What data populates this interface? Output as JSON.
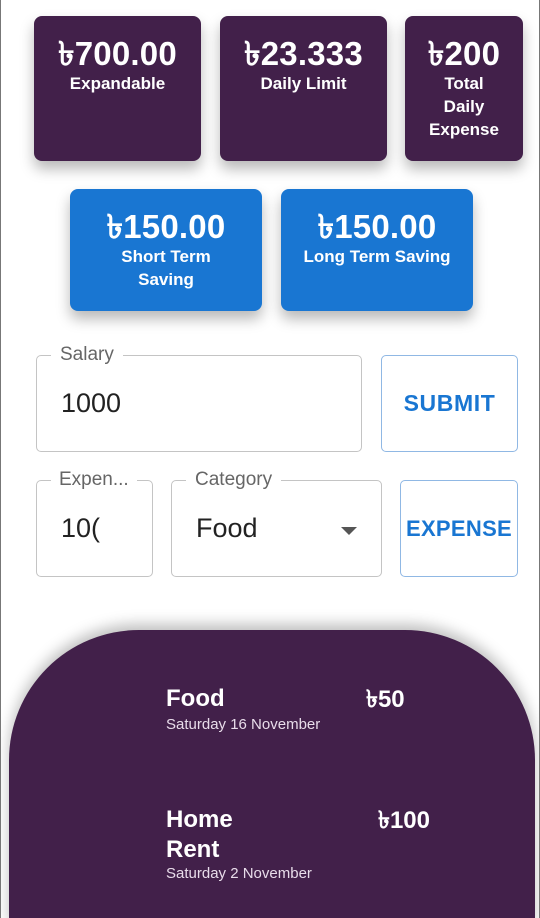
{
  "summary": {
    "expandable": {
      "amount": "৳700.00",
      "label": "Expandable"
    },
    "daily_limit": {
      "amount": "৳23.333",
      "label": "Daily Limit"
    },
    "total_daily_expense": {
      "amount": "৳200",
      "label_lines": [
        "Total",
        "Daily",
        "Expense"
      ]
    }
  },
  "savings": {
    "short_term": {
      "amount": "৳150.00",
      "label_lines": [
        "Short Term",
        "Saving"
      ]
    },
    "long_term": {
      "amount": "৳150.00",
      "label": "Long Term Saving"
    }
  },
  "salary_form": {
    "label": "Salary",
    "value": "1000",
    "submit_label": "SUBMIT"
  },
  "expense_form": {
    "amount_label": "Expen...",
    "amount_value": "10(",
    "category_label": "Category",
    "category_value": "Food",
    "expense_label": "EXPENSE"
  },
  "expenses": [
    {
      "title_lines": [
        "Food"
      ],
      "date": "Saturday 16 November",
      "amount": "৳50"
    },
    {
      "title_lines": [
        "Home",
        "Rent"
      ],
      "date": "Saturday 2 November",
      "amount": "৳100"
    }
  ],
  "colors": {
    "card_purple": "#42204a",
    "card_blue": "#1976d2",
    "accent": "#1976d2"
  },
  "icons": {
    "category_dropdown": "caret-down-icon"
  }
}
